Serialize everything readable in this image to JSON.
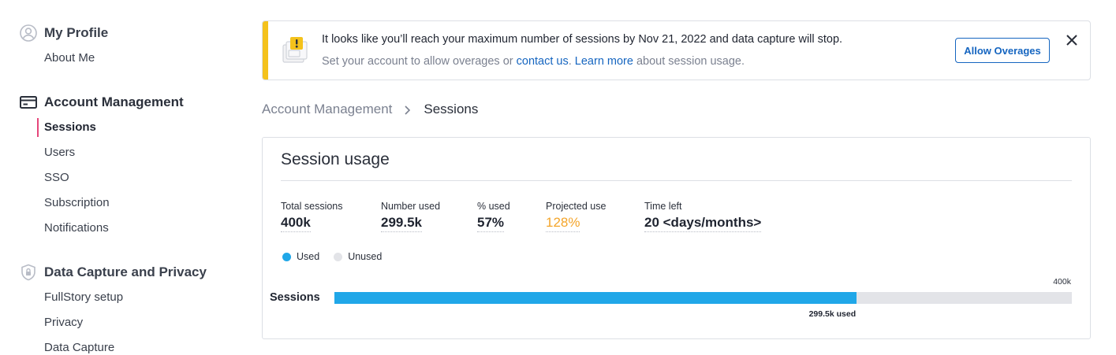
{
  "sidebar": {
    "profile": {
      "title": "My Profile",
      "icon": "user-circle-icon",
      "items": [
        "About Me"
      ]
    },
    "account": {
      "title": "Account Management",
      "icon": "credit-card-icon",
      "items": [
        "Sessions",
        "Users",
        "SSO",
        "Subscription",
        "Notifications"
      ],
      "active": "Sessions"
    },
    "privacy": {
      "title": "Data Capture and Privacy",
      "icon": "shield-lock-icon",
      "items": [
        "FullStory setup",
        "Privacy",
        "Data Capture"
      ]
    }
  },
  "banner": {
    "icon": "warning-document-icon",
    "message": "It looks like you’ll reach your maximum number of sessions by Nov 21, 2022 and data capture will stop.",
    "sub_prefix": "Set your account to allow overages or ",
    "contact_link": "contact us",
    "sub_mid": ". ",
    "learn_link": "Learn more",
    "sub_suffix": " about session usage.",
    "button_label": "Allow Overages",
    "accent_color": "#f4c21b"
  },
  "breadcrumb": {
    "parent": "Account Management",
    "current": "Sessions"
  },
  "card": {
    "title": "Session usage",
    "stats": [
      {
        "label": "Total sessions",
        "value": "400k"
      },
      {
        "label": "Number used",
        "value": "299.5k"
      },
      {
        "label": "% used",
        "value": "57%"
      },
      {
        "label": "Projected use",
        "value": "128%"
      },
      {
        "label": "Time left",
        "value": "20 <days/months>"
      }
    ],
    "legend": {
      "used": "Used",
      "unused": "Unused",
      "used_color": "#20a7e8",
      "unused_color": "#e3e4e8"
    },
    "bar": {
      "name": "Sessions",
      "max_label": "400k",
      "used_label": "299.5k used",
      "used_fraction": 0.7076
    }
  }
}
